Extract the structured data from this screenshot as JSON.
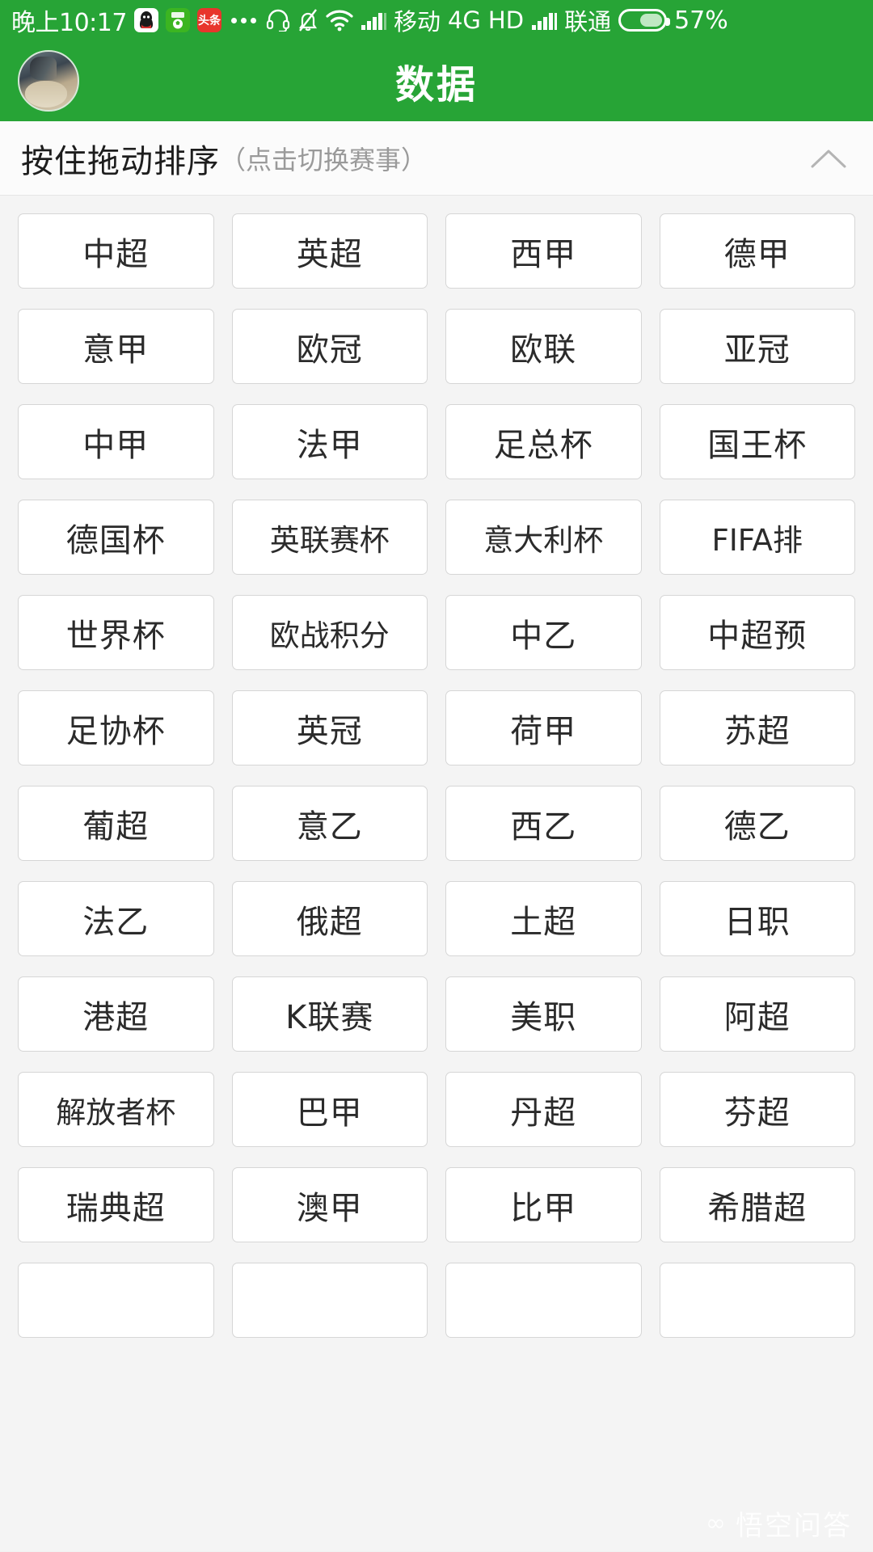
{
  "status_bar": {
    "time": "晚上10:17",
    "app_icons": [
      {
        "name": "qq-icon",
        "glyph": "🐧"
      },
      {
        "name": "football-app-icon",
        "glyph": "⚽"
      },
      {
        "name": "toutiao-icon",
        "glyph": "头条"
      }
    ],
    "overflow": "...",
    "carrier_primary": "移动",
    "network_type": "4G",
    "volte": "HD",
    "carrier_secondary": "联通",
    "battery_percent": "57%",
    "battery_level": 57,
    "icons": [
      "headset-icon",
      "bell-muted-icon",
      "wifi-icon",
      "signal-icon",
      "signal-icon-2",
      "battery-icon"
    ],
    "background_color": "#27a436",
    "foreground_color": "#ffffff"
  },
  "header": {
    "title": "数据",
    "avatar_name": "user-avatar",
    "background_color": "#27a436"
  },
  "section": {
    "title": "按住拖动排序",
    "subtitle": "（点击切换赛事）",
    "collapse_icon": "chevron-up-icon"
  },
  "grid": {
    "columns": 4,
    "tiles": [
      "中超",
      "英超",
      "西甲",
      "德甲",
      "意甲",
      "欧冠",
      "欧联",
      "亚冠",
      "中甲",
      "法甲",
      "足总杯",
      "国王杯",
      "德国杯",
      "英联赛杯",
      "意大利杯",
      "FIFA排",
      "世界杯",
      "欧战积分",
      "中乙",
      "中超预",
      "足协杯",
      "英冠",
      "荷甲",
      "苏超",
      "葡超",
      "意乙",
      "西乙",
      "德乙",
      "法乙",
      "俄超",
      "土超",
      "日职",
      "港超",
      "K联赛",
      "美职",
      "阿超",
      "解放者杯",
      "巴甲",
      "丹超",
      "芬超",
      "瑞典超",
      "澳甲",
      "比甲",
      "希腊超",
      "",
      "",
      "",
      ""
    ]
  },
  "watermark": {
    "text": "悟空问答",
    "mark": "∞"
  },
  "colors": {
    "brand_green": "#27a436",
    "page_background": "#f4f4f4",
    "tile_background": "#ffffff",
    "tile_border": "#d6d6d6",
    "text_primary": "#2b2b2b",
    "text_muted": "#9a9a9a"
  }
}
